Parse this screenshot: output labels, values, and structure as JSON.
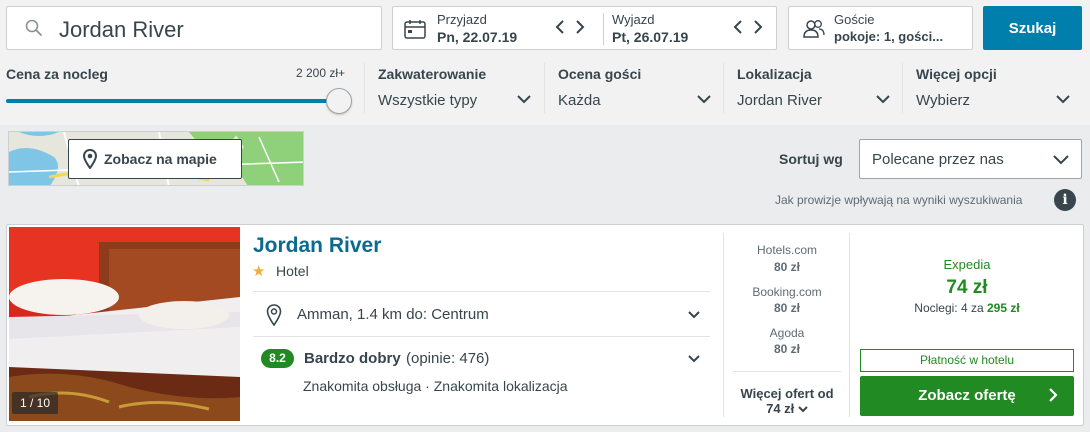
{
  "search": {
    "query": "Jordan River"
  },
  "dates": {
    "checkin_label": "Przyjazd",
    "checkin_value": "Pn, 22.07.19",
    "checkout_label": "Wyjazd",
    "checkout_value": "Pt, 26.07.19"
  },
  "guests": {
    "label": "Goście",
    "value": "pokoje: 1, gości..."
  },
  "search_button": "Szukaj",
  "filters": {
    "price_label": "Cena za nocleg",
    "price_max": "2 200 zł+",
    "price_level_fraction": 1.0,
    "accommodation_label": "Zakwaterowanie",
    "accommodation_value": "Wszystkie typy",
    "rating_label": "Ocena gości",
    "rating_value": "Każda",
    "location_label": "Lokalizacja",
    "location_value": "Jordan River",
    "more_label": "Więcej opcji",
    "more_value": "Wybierz"
  },
  "map_button": "Zobacz na mapie",
  "sort": {
    "label": "Sortuj wg",
    "value": "Polecane przez nas"
  },
  "info_text": "Jak prowizje wpływają na wyniki wyszukiwania",
  "hotel": {
    "name": "Jordan River",
    "type": "Hotel",
    "photo_counter": "1 / 10",
    "location": "Amman, 1.4 km do: Centrum",
    "rating_score": "8.2",
    "rating_word": "Bardzo dobry",
    "rating_count": "(opinie: 476)",
    "rating_features": "Znakomita obsługa · Znakomita lokalizacja",
    "deals": [
      {
        "site": "Hotels.com",
        "price": "80 zł"
      },
      {
        "site": "Booking.com",
        "price": "80 zł"
      },
      {
        "site": "Agoda",
        "price": "80 zł"
      }
    ],
    "more_offers_line1": "Więcej ofert od",
    "more_offers_line2": "74 zł",
    "best_site": "Expedia",
    "best_price": "74 zł",
    "nights_text": "Noclegi: 4 za",
    "nights_total": "295 zł",
    "payment_note": "Płatność w hotelu",
    "offer_button": "Zobacz ofertę"
  },
  "colors": {
    "accent": "#007fad",
    "green": "#218a22",
    "name_blue": "#0a6a8f"
  }
}
